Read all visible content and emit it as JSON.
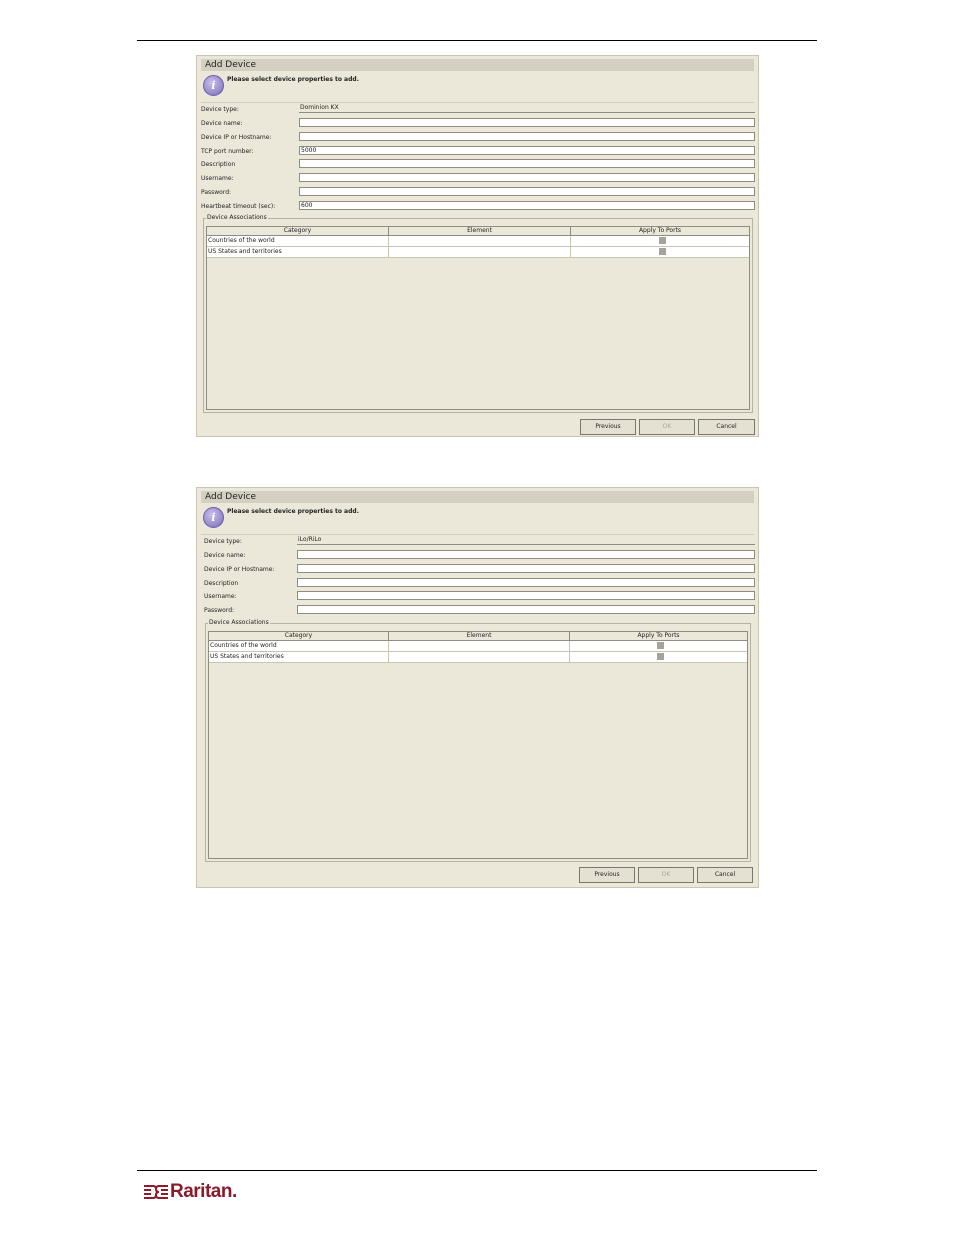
{
  "dialogs": [
    {
      "title": "Add Device",
      "subtitle": "Please select device properties to add.",
      "fields": [
        {
          "label": "Device type:",
          "value": "Dominion KX",
          "static": true
        },
        {
          "label": "Device name:",
          "value": ""
        },
        {
          "label": "Device IP or Hostname:",
          "value": ""
        },
        {
          "label": "TCP port number:",
          "value": "5000"
        },
        {
          "label": "Description",
          "value": ""
        },
        {
          "label": "Username:",
          "value": ""
        },
        {
          "label": "Password:",
          "value": ""
        },
        {
          "label": "Heartbeat timeout (sec):",
          "value": "600"
        }
      ],
      "associations": {
        "legend": "Device Associations",
        "columns": [
          "Category",
          "Element",
          "Apply To Ports"
        ],
        "rows": [
          {
            "category": "Countries of the world",
            "element": ""
          },
          {
            "category": "US States and territories",
            "element": ""
          }
        ]
      },
      "buttons": {
        "previous": "Previous",
        "ok": "OK",
        "cancel": "Cancel"
      }
    },
    {
      "title": "Add Device",
      "subtitle": "Please select device properties to add.",
      "fields": [
        {
          "label": "Device type:",
          "value": "iLo/RiLo",
          "static": true
        },
        {
          "label": "Device name:",
          "value": ""
        },
        {
          "label": "Device IP or Hostname:",
          "value": ""
        },
        {
          "label": "Description",
          "value": ""
        },
        {
          "label": "Username:",
          "value": ""
        },
        {
          "label": "Password:",
          "value": ""
        }
      ],
      "associations": {
        "legend": "Device Associations",
        "columns": [
          "Category",
          "Element",
          "Apply To Ports"
        ],
        "rows": [
          {
            "category": "Countries of the world",
            "element": ""
          },
          {
            "category": "US States and territories",
            "element": ""
          }
        ]
      },
      "buttons": {
        "previous": "Previous",
        "ok": "OK",
        "cancel": "Cancel"
      }
    }
  ],
  "footer": {
    "logo_text": "Raritan.",
    "logo_color": "#8b1a2b"
  }
}
